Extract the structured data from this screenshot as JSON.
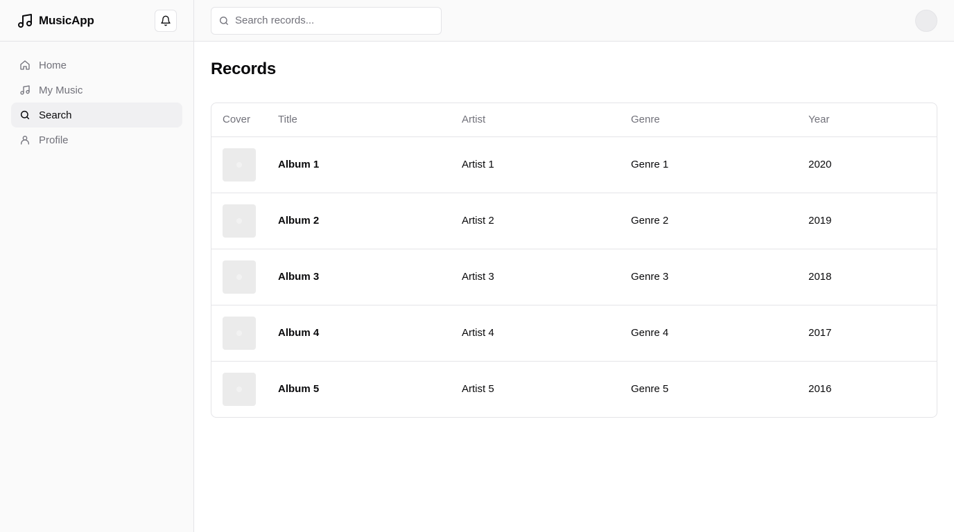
{
  "app": {
    "name": "MusicApp"
  },
  "sidebar": {
    "items": [
      {
        "label": "Home",
        "icon": "home-icon",
        "active": false
      },
      {
        "label": "My Music",
        "icon": "music-note-icon",
        "active": false
      },
      {
        "label": "Search",
        "icon": "search-icon",
        "active": true
      },
      {
        "label": "Profile",
        "icon": "user-icon",
        "active": false
      }
    ]
  },
  "topbar": {
    "search": {
      "placeholder": "Search records...",
      "value": ""
    }
  },
  "page": {
    "title": "Records"
  },
  "table": {
    "columns": [
      "Cover",
      "Title",
      "Artist",
      "Genre",
      "Year"
    ],
    "rows": [
      {
        "title": "Album 1",
        "artist": "Artist 1",
        "genre": "Genre 1",
        "year": "2020"
      },
      {
        "title": "Album 2",
        "artist": "Artist 2",
        "genre": "Genre 2",
        "year": "2019"
      },
      {
        "title": "Album 3",
        "artist": "Artist 3",
        "genre": "Genre 3",
        "year": "2018"
      },
      {
        "title": "Album 4",
        "artist": "Artist 4",
        "genre": "Genre 4",
        "year": "2017"
      },
      {
        "title": "Album 5",
        "artist": "Artist 5",
        "genre": "Genre 5",
        "year": "2016"
      }
    ]
  },
  "colors": {
    "sidebar_bg": "#fafafa",
    "active_item_bg": "#f0f0f2",
    "muted_text": "#71717a",
    "border": "#e4e4e7",
    "cover_placeholder": "#ebebeb"
  }
}
